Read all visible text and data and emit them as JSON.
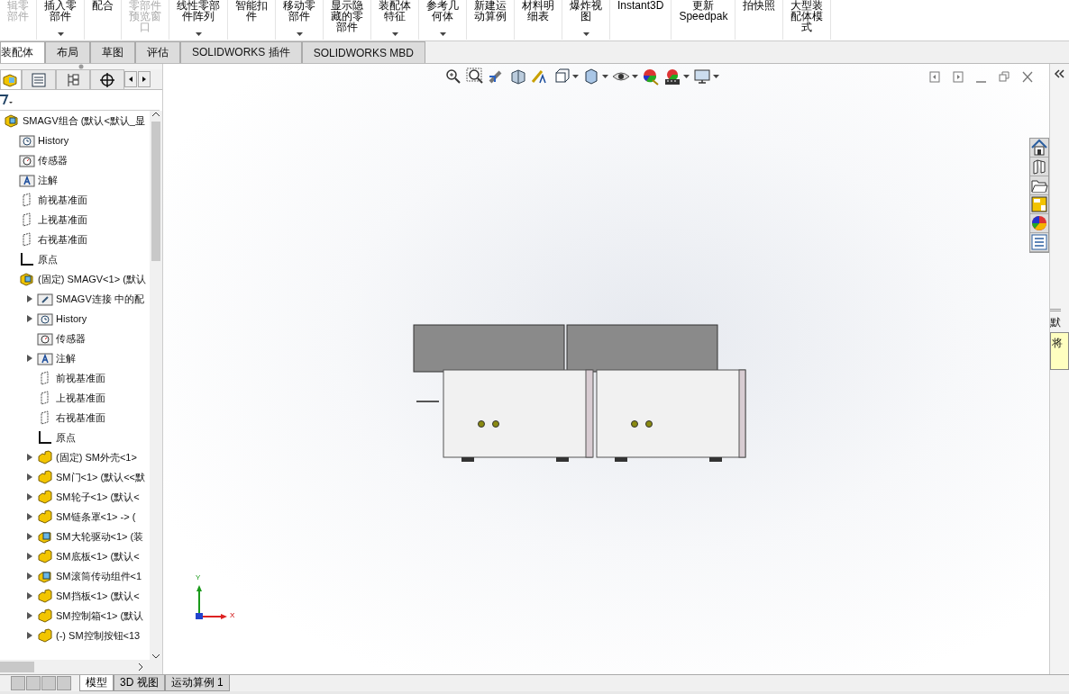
{
  "ribbon": [
    {
      "lines": [
        "辑零",
        "部件"
      ],
      "disabled": true,
      "dropdown": false
    },
    {
      "lines": [
        "插入零",
        "部件"
      ],
      "disabled": false,
      "dropdown": true
    },
    {
      "lines": [
        "配合"
      ],
      "disabled": false,
      "dropdown": false
    },
    {
      "lines": [
        "零部件",
        "预览窗",
        "口"
      ],
      "disabled": true,
      "dropdown": false
    },
    {
      "lines": [
        "线性零部",
        "件阵列"
      ],
      "disabled": false,
      "dropdown": true
    },
    {
      "lines": [
        "智能扣",
        "件"
      ],
      "disabled": false,
      "dropdown": false
    },
    {
      "lines": [
        "移动零",
        "部件"
      ],
      "disabled": false,
      "dropdown": true
    },
    {
      "lines": [
        "显示隐",
        "藏的零",
        "部件"
      ],
      "disabled": false,
      "dropdown": false
    },
    {
      "lines": [
        "装配体",
        "特征"
      ],
      "disabled": false,
      "dropdown": true
    },
    {
      "lines": [
        "参考几",
        "何体"
      ],
      "disabled": false,
      "dropdown": true
    },
    {
      "lines": [
        "新建运",
        "动算例"
      ],
      "disabled": false,
      "dropdown": false
    },
    {
      "lines": [
        "材料明",
        "细表"
      ],
      "disabled": false,
      "dropdown": false
    },
    {
      "lines": [
        "爆炸视",
        "图"
      ],
      "disabled": false,
      "dropdown": true
    },
    {
      "lines": [
        "Instant3D"
      ],
      "disabled": false,
      "dropdown": false
    },
    {
      "lines": [
        "更新",
        "Speedpak"
      ],
      "disabled": false,
      "dropdown": false
    },
    {
      "lines": [
        "拍快照"
      ],
      "disabled": false,
      "dropdown": false
    },
    {
      "lines": [
        "大型装",
        "配体模",
        "式"
      ],
      "disabled": false,
      "dropdown": false
    }
  ],
  "tabs": [
    {
      "label": "装配体",
      "selected": true
    },
    {
      "label": "布局",
      "selected": false
    },
    {
      "label": "草图",
      "selected": false
    },
    {
      "label": "评估",
      "selected": false
    },
    {
      "label": "SOLIDWORKS 插件",
      "selected": false
    },
    {
      "label": "SOLIDWORKS MBD",
      "selected": false
    }
  ],
  "tree": [
    {
      "kind": "assembly",
      "label": "SMAGV组合  (默认<默认_显",
      "arrow": false,
      "children": [
        {
          "kind": "history",
          "label": "History",
          "arrow": false
        },
        {
          "kind": "sensor",
          "label": "传感器",
          "arrow": false
        },
        {
          "kind": "annotation",
          "label": "注解",
          "arrow": false
        },
        {
          "kind": "plane",
          "label": "前视基准面",
          "arrow": false
        },
        {
          "kind": "plane",
          "label": "上视基准面",
          "arrow": false
        },
        {
          "kind": "plane",
          "label": "右视基准面",
          "arrow": false
        },
        {
          "kind": "origin",
          "label": "原点",
          "arrow": false
        },
        {
          "kind": "assembly",
          "label": "(固定) SMAGV<1> (默认",
          "arrow": false,
          "children": [
            {
              "kind": "mates",
              "label": "SMAGV连接 中的配",
              "arrow": true
            },
            {
              "kind": "history",
              "label": "History",
              "arrow": true
            },
            {
              "kind": "sensor",
              "label": "传感器",
              "arrow": false
            },
            {
              "kind": "annotation",
              "label": "注解",
              "arrow": true
            },
            {
              "kind": "plane",
              "label": "前视基准面",
              "arrow": false
            },
            {
              "kind": "plane",
              "label": "上视基准面",
              "arrow": false
            },
            {
              "kind": "plane",
              "label": "右视基准面",
              "arrow": false
            },
            {
              "kind": "origin",
              "label": "原点",
              "arrow": false
            },
            {
              "kind": "part",
              "label": "(固定) SM外壳<1>",
              "arrow": true
            },
            {
              "kind": "part",
              "label": "SM门<1> (默认<<默",
              "arrow": true
            },
            {
              "kind": "part",
              "label": "SM轮子<1> (默认<",
              "arrow": true
            },
            {
              "kind": "part",
              "label": "SM链条罩<1> -> (",
              "arrow": true
            },
            {
              "kind": "subassembly",
              "label": "SM大轮驱动<1> (装",
              "arrow": true
            },
            {
              "kind": "part",
              "label": "SM底板<1> (默认<",
              "arrow": true
            },
            {
              "kind": "subassembly",
              "label": "SM滚筒传动组件<1",
              "arrow": true
            },
            {
              "kind": "part",
              "label": "SM挡板<1> (默认<",
              "arrow": true
            },
            {
              "kind": "part",
              "label": "SM控制箱<1> (默认",
              "arrow": true
            },
            {
              "kind": "part",
              "label": "(-) SM控制按钮<13",
              "arrow": true
            }
          ]
        }
      ]
    }
  ],
  "triad": {
    "y_label": "Y",
    "x_label": "X"
  },
  "task_pane": {
    "heading": "默",
    "note": "将"
  },
  "bottom_tabs": [
    {
      "label": "模型",
      "selected": true
    },
    {
      "label": "3D 视图",
      "selected": false
    },
    {
      "label": "运动算例 1",
      "selected": false
    }
  ]
}
